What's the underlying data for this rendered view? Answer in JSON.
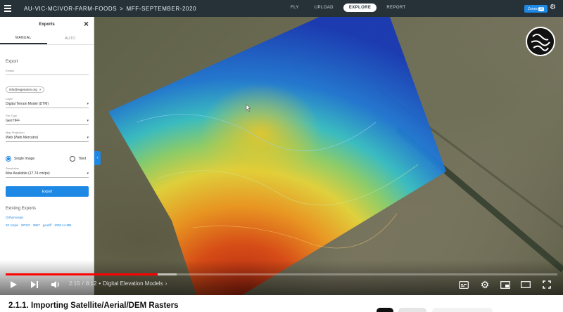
{
  "topbar": {
    "project": "AU-VIC-MCIVOR-FARM-FOODS",
    "separator": ">",
    "dataset": "MFF-SEPTEMBER-2020",
    "nav": [
      {
        "label": "FLY",
        "active": false
      },
      {
        "label": "UPLOAD",
        "active": false
      },
      {
        "label": "EXPLORE",
        "active": true
      },
      {
        "label": "REPORT",
        "active": false
      }
    ],
    "zones_label": "Zones",
    "zones_count": "16"
  },
  "panel": {
    "title": "Exports",
    "tabs": [
      {
        "label": "MANUAL",
        "active": true
      },
      {
        "label": "AUTO",
        "active": false
      }
    ],
    "export_heading": "Export",
    "emails_label": "Emails",
    "email_chip": "info@regenanm.org",
    "layer_label": "Layer",
    "layer_value": "Digital Terrain Model (DTM)",
    "filetype_label": "File Type",
    "filetype_value": "GeoTIFF",
    "projection_label": "Map Projection",
    "projection_value": "Web (Web Mercator)",
    "single_image_label": "Single Image",
    "tiled_label": "Tiled",
    "resolution_label": "Resolution",
    "resolution_value": "Max Available (17.74 cm/px)",
    "export_button": "Export",
    "existing_heading": "Existing Exports",
    "existing_item": "Orthomosaic",
    "existing_meta": [
      "20 cm/px",
      "EPSG",
      "3857",
      "geotiff",
      "1036.14 MB"
    ]
  },
  "player": {
    "current_time": "2:15",
    "separator": "/",
    "duration": "8:12",
    "bullet": "•",
    "chapter": "Digital Elevation Models",
    "chapter_chevron": "›",
    "progress_played": 0.275,
    "progress_buffered": 0.31,
    "icons": [
      "play-icon",
      "next-icon",
      "volume-icon",
      "subtitles-icon",
      "settings-icon",
      "miniplayer-icon",
      "theater-icon",
      "fullscreen-icon"
    ]
  },
  "video": {
    "title": "2.1.1. Importing Satellite/Aerial/DEM Rasters"
  },
  "colors": {
    "topbar": "#263238",
    "accent": "#1e88e5",
    "progress": "#ff0000"
  }
}
